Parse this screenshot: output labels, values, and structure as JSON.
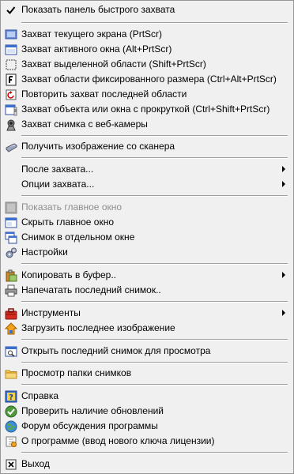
{
  "menu": {
    "items": [
      {
        "label": "Показать панель быстрого захвата",
        "icon": "checkmark-icon"
      },
      {
        "label": "Захват текущего экрана (PrtScr)",
        "icon": "screen-capture-icon"
      },
      {
        "label": "Захват активного окна (Alt+PrtScr)",
        "icon": "window-capture-icon"
      },
      {
        "label": "Захват выделенной области (Shift+PrtScr)",
        "icon": "region-capture-icon"
      },
      {
        "label": "Захват области фиксированного размера (Ctrl+Alt+PrtScr)",
        "icon": "fixed-region-icon"
      },
      {
        "label": "Повторить захват последней области",
        "icon": "repeat-capture-icon"
      },
      {
        "label": "Захват объекта или окна с прокруткой (Ctrl+Shift+PrtScr)",
        "icon": "scroll-capture-icon"
      },
      {
        "label": "Захват снимка с веб-камеры",
        "icon": "webcam-icon"
      },
      {
        "label": "Получить изображение со сканера",
        "icon": "scanner-icon"
      },
      {
        "label": "После захвата...",
        "icon": ""
      },
      {
        "label": "Опции захвата...",
        "icon": ""
      },
      {
        "label": "Показать главное окно",
        "icon": "show-window-icon"
      },
      {
        "label": "Скрыть главное окно",
        "icon": "hide-window-icon"
      },
      {
        "label": "Снимок в отдельном окне",
        "icon": "separate-window-icon"
      },
      {
        "label": "Настройки",
        "icon": "settings-icon"
      },
      {
        "label": "Копировать в буфер..",
        "icon": "clipboard-icon"
      },
      {
        "label": "Напечатать последний снимок..",
        "icon": "printer-icon"
      },
      {
        "label": "Инструменты",
        "icon": "tools-icon"
      },
      {
        "label": "Загрузить последнее изображение",
        "icon": "upload-icon"
      },
      {
        "label": "Открыть последний снимок для просмотра",
        "icon": "open-viewer-icon"
      },
      {
        "label": "Просмотр папки снимков",
        "icon": "folder-icon"
      },
      {
        "label": "Справка",
        "icon": "help-icon"
      },
      {
        "label": "Проверить наличие обновлений",
        "icon": "update-check-icon"
      },
      {
        "label": "Форум обсуждения программы",
        "icon": "forum-icon"
      },
      {
        "label": "О программе (ввод нового ключа лицензии)",
        "icon": "about-icon"
      },
      {
        "label": "Выход",
        "icon": "exit-icon"
      }
    ],
    "colors": {
      "menu_background": "#f0f0f0",
      "disabled_text": "#8e8e8e",
      "separator": "#a0a0a0"
    }
  }
}
